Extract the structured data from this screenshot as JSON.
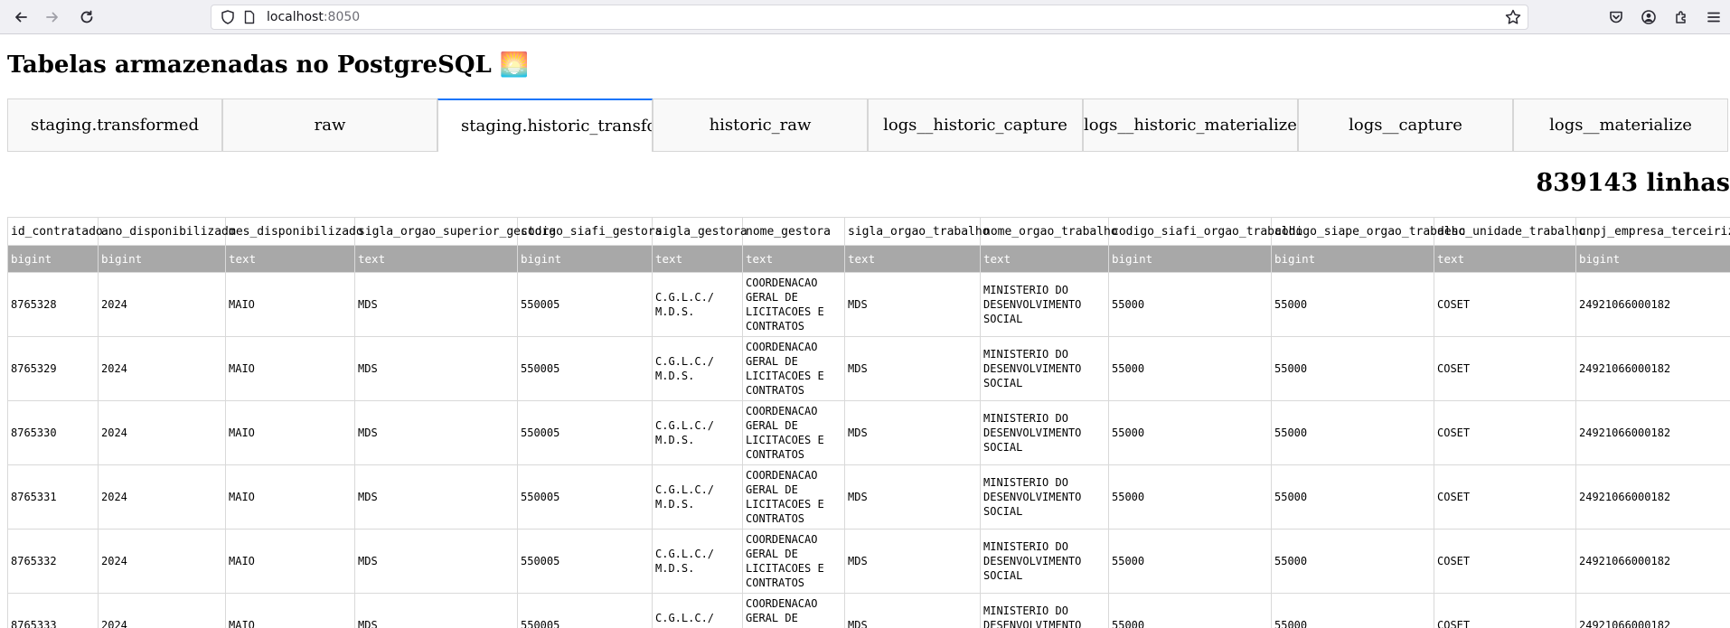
{
  "browser": {
    "url_host": "localhost",
    "url_port": ":8050"
  },
  "page": {
    "title": "Tabelas armazenadas no PostgreSQL 🌅",
    "row_count": "839143 linhas"
  },
  "tabs": [
    {
      "label": "staging.transformed"
    },
    {
      "label": "raw"
    },
    {
      "label": "staging.historic_transformed",
      "selected": true
    },
    {
      "label": "historic_raw"
    },
    {
      "label": "logs__historic_capture"
    },
    {
      "label": "logs__historic_materialize"
    },
    {
      "label": "logs__capture"
    },
    {
      "label": "logs__materialize"
    }
  ],
  "table": {
    "columns": [
      {
        "name": "id_contratado",
        "type": "bigint"
      },
      {
        "name": "ano_disponibilizado",
        "type": "bigint"
      },
      {
        "name": "mes_disponibilizado",
        "type": "text"
      },
      {
        "name": "sigla_orgao_superior_gestora",
        "type": "text"
      },
      {
        "name": "codigo_siafi_gestora",
        "type": "bigint"
      },
      {
        "name": "sigla_gestora",
        "type": "text"
      },
      {
        "name": "nome_gestora",
        "type": "text"
      },
      {
        "name": "sigla_orgao_trabalho",
        "type": "text"
      },
      {
        "name": "nome_orgao_trabalho",
        "type": "text"
      },
      {
        "name": "codigo_siafi_orgao_trabalho",
        "type": "bigint"
      },
      {
        "name": "codigo_siape_orgao_trabalho",
        "type": "bigint"
      },
      {
        "name": "desc_unidade_trabalho",
        "type": "text"
      },
      {
        "name": "cnpj_empresa_terceirizada",
        "type": "bigint"
      }
    ],
    "rows": [
      [
        "8765328",
        "2024",
        "MAIO",
        "MDS",
        "550005",
        "C.G.L.C./ M.D.S.",
        "COORDENACAO GERAL DE LICITACOES E CONTRATOS",
        "MDS",
        "MINISTERIO DO DESENVOLVIMENTO SOCIAL",
        "55000",
        "55000",
        "COSET",
        "24921066000182"
      ],
      [
        "8765329",
        "2024",
        "MAIO",
        "MDS",
        "550005",
        "C.G.L.C./ M.D.S.",
        "COORDENACAO GERAL DE LICITACOES E CONTRATOS",
        "MDS",
        "MINISTERIO DO DESENVOLVIMENTO SOCIAL",
        "55000",
        "55000",
        "COSET",
        "24921066000182"
      ],
      [
        "8765330",
        "2024",
        "MAIO",
        "MDS",
        "550005",
        "C.G.L.C./ M.D.S.",
        "COORDENACAO GERAL DE LICITACOES E CONTRATOS",
        "MDS",
        "MINISTERIO DO DESENVOLVIMENTO SOCIAL",
        "55000",
        "55000",
        "COSET",
        "24921066000182"
      ],
      [
        "8765331",
        "2024",
        "MAIO",
        "MDS",
        "550005",
        "C.G.L.C./ M.D.S.",
        "COORDENACAO GERAL DE LICITACOES E CONTRATOS",
        "MDS",
        "MINISTERIO DO DESENVOLVIMENTO SOCIAL",
        "55000",
        "55000",
        "COSET",
        "24921066000182"
      ],
      [
        "8765332",
        "2024",
        "MAIO",
        "MDS",
        "550005",
        "C.G.L.C./ M.D.S.",
        "COORDENACAO GERAL DE LICITACOES E CONTRATOS",
        "MDS",
        "MINISTERIO DO DESENVOLVIMENTO SOCIAL",
        "55000",
        "55000",
        "COSET",
        "24921066000182"
      ],
      [
        "8765333",
        "2024",
        "MAIO",
        "MDS",
        "550005",
        "C.G.L.C./ M.D.S.",
        "COORDENACAO GERAL DE LICITACOES E CONTRATOS",
        "MDS",
        "MINISTERIO DO DESENVOLVIMENTO SOCIAL",
        "55000",
        "55000",
        "COSET",
        "24921066000182"
      ]
    ]
  }
}
